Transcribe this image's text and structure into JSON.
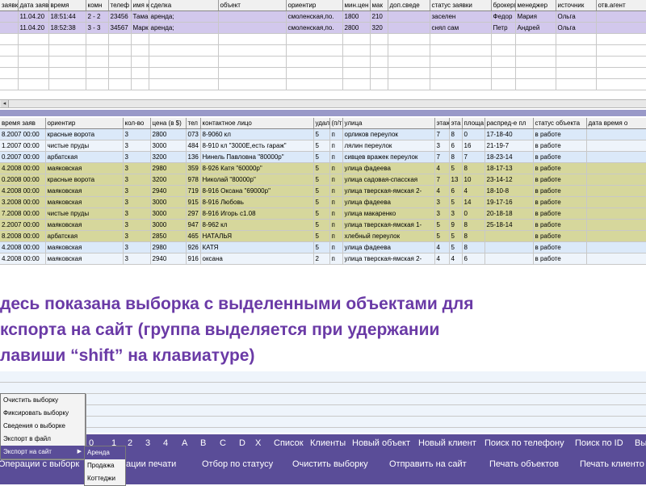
{
  "top_table": {
    "headers": [
      "заявки",
      "дата заяв",
      "время",
      "комн",
      "телеф",
      "имя к",
      "сделка",
      "объект",
      "ориентир",
      "мин.цен",
      "мак",
      "доп.сведе",
      "статус заявки",
      "брокер(сня",
      "менеджер",
      "источник",
      "отв.агент"
    ],
    "rows": [
      [
        "",
        "11.04.20",
        "18:51:44",
        "2 - 2",
        "23456",
        "Тама",
        "аренда;",
        "",
        "смоленская,по.",
        "1800",
        "210",
        "",
        "заселен",
        "Федор",
        "Мария",
        "Ольга",
        ""
      ],
      [
        "",
        "11.04.20",
        "18:52:38",
        "3 - 3",
        "34567",
        "Марк",
        "аренда;",
        "",
        "смоленская,по.",
        "2800",
        "320",
        "",
        "снял сам",
        "Петр",
        "Андрей",
        "Ольга",
        ""
      ]
    ]
  },
  "main_table": {
    "headers": [
      "время заяв",
      "ориентир",
      "кол-во",
      "цена (в $)",
      "тел",
      "контактное лицо",
      "удал",
      "(п/т",
      "улица",
      "этаж",
      "эта",
      "площа",
      "распред-е пл",
      "статус объекта",
      "дата время о"
    ],
    "rows": [
      {
        "style": "blu",
        "cells": [
          "8.2007 00:00",
          "красные ворота",
          "3",
          "2800",
          "073",
          "8-9060 кл",
          "5",
          "п",
          "орликов переулок",
          "7",
          "8",
          "0",
          "17-18-40",
          "в работе",
          ""
        ]
      },
      {
        "style": "wht",
        "cells": [
          "1.2007 00:00",
          "чистые пруды",
          "3",
          "3000",
          "484",
          "8-910 кл \"3000Е,есть гараж\"",
          "5",
          "п",
          "лялин переулок",
          "3",
          "6",
          "16",
          "21-19-7",
          "в работе",
          ""
        ]
      },
      {
        "style": "blu",
        "cells": [
          "0.2007 00:00",
          "арбатская",
          "3",
          "3200",
          "136",
          "Нинель Павловна \"80000р\"",
          "5",
          "п",
          "сивцев вражек переулок",
          "7",
          "8",
          "7",
          "18-23-14",
          "в работе",
          ""
        ]
      },
      {
        "style": "olv",
        "cells": [
          "4.2008 00:00",
          "маяковская",
          "3",
          "2980",
          "359",
          "8-926 Катя \"60000р\"",
          "5",
          "п",
          "улица фадеева",
          "4",
          "5",
          "8",
          "18-17-13",
          "в работе",
          ""
        ]
      },
      {
        "style": "olv",
        "cells": [
          "0.2008 00:00",
          "красные ворота",
          "3",
          "3200",
          "978",
          "Николай \"80000р\"",
          "5",
          "п",
          "улица садовая-спасская",
          "7",
          "13",
          "10",
          "23-14-12",
          "в работе",
          ""
        ]
      },
      {
        "style": "olv",
        "cells": [
          "4.2008 00:00",
          "маяковская",
          "3",
          "2940",
          "719",
          "8-916 Оксана \"69000р\"",
          "5",
          "п",
          "улица тверская-ямская 2-",
          "4",
          "6",
          "4",
          "18-10-8",
          "в работе",
          ""
        ]
      },
      {
        "style": "olv",
        "cells": [
          "3.2008 00:00",
          "маяковская",
          "3",
          "3000",
          "915",
          "8-916 Любовь",
          "5",
          "п",
          "улица фадеева",
          "3",
          "5",
          "14",
          "19-17-16",
          "в работе",
          ""
        ]
      },
      {
        "style": "olv",
        "cells": [
          "7.2008 00:00",
          "чистые пруды",
          "3",
          "3000",
          "297",
          "8-916 Игорь  с1.08",
          "5",
          "п",
          "улица макаренко",
          "3",
          "3",
          "0",
          "20-18-18",
          "в работе",
          ""
        ]
      },
      {
        "style": "olv",
        "cells": [
          "2.2007 00:00",
          "маяковская",
          "3",
          "3000",
          "947",
          "8-962 кл",
          "5",
          "п",
          "улица тверская-ямская 1-",
          "5",
          "9",
          "8",
          "25-18-14",
          "в работе",
          ""
        ]
      },
      {
        "style": "olv",
        "cells": [
          "8.2008 00:00",
          "арбатская",
          "3",
          "2850",
          "465",
          "НАТАЛЬЯ",
          "5",
          "п",
          "хлебный переулок",
          "5",
          "5",
          "8",
          "",
          "в работе",
          ""
        ]
      },
      {
        "style": "blu",
        "cells": [
          "4.2008 00:00",
          "маяковская",
          "3",
          "2980",
          "926",
          "КАТЯ",
          "5",
          "п",
          "улица фадеева",
          "4",
          "5",
          "8",
          "",
          "в работе",
          ""
        ]
      },
      {
        "style": "wht",
        "cells": [
          "4.2008 00:00",
          "маяковская",
          "3",
          "2940",
          "916",
          "оксана",
          "2",
          "п",
          "улица тверская-ямская 2-",
          "4",
          "4",
          "6",
          "",
          "в работе",
          ""
        ]
      }
    ]
  },
  "overlay": {
    "line1": "десь показана выборка с выделенными объектами для",
    "line2": "кспорта на сайт (группа выделяется при удержании",
    "line3": "лавиши “shift” на клавиатуре)"
  },
  "nav_row1": [
    "0",
    "1",
    "2",
    "3",
    "4",
    "A",
    "B",
    "C",
    "D",
    "X",
    "Список",
    "Клиенты",
    "Новый объект",
    "Новый клиент",
    "Поиск по телефону",
    "Поиск по ID",
    "Вы"
  ],
  "nav_row2": [
    "Операции с выборк",
    "ации печати",
    "Отбор  по статусу",
    "Очистить выборку",
    "Отправить на сайт",
    "Печать объектов",
    "Печать клиенто"
  ],
  "context_menu": {
    "items": [
      "Очистить выборку",
      "Фиксировать выборку",
      "Сведения о выборке",
      "Экспорт в файл",
      "Экспорт на сайт"
    ],
    "arrow": "▶"
  },
  "submenu": {
    "items": [
      "Аренда",
      "Продажа",
      "Коттеджи"
    ]
  },
  "colors": {
    "purple_row": "#d2c8ec",
    "blue_row": "#dbe9f9",
    "olive_row": "#d6d79c",
    "nav_bar": "#5a4d98",
    "overlay_text": "#6a3aa6"
  }
}
